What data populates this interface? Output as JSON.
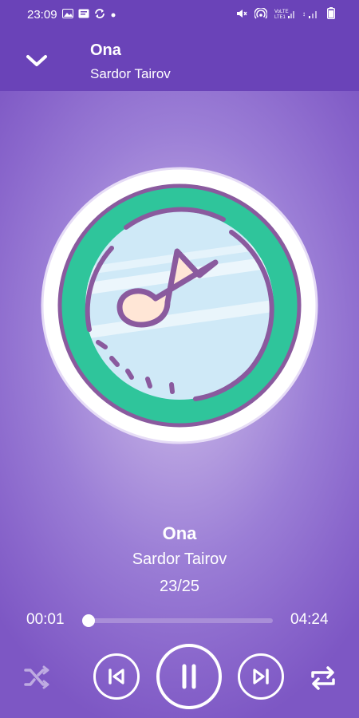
{
  "status_bar": {
    "time": "23:09",
    "left_icons": [
      "gallery-icon",
      "message-icon",
      "sync-icon",
      "dot-icon"
    ],
    "right_icons": [
      "mute-icon",
      "hotspot-icon",
      "signal-volte-lte-icon",
      "signal-icon",
      "battery-icon"
    ]
  },
  "header": {
    "title": "Ona",
    "artist": "Sardor Tairov"
  },
  "now_playing": {
    "title": "Ona",
    "artist": "Sardor Tairov",
    "track_position": "23/25"
  },
  "progress": {
    "current_time": "00:01",
    "total_time": "04:24",
    "fraction": 0.004
  },
  "controls": {
    "shuffle_enabled": false,
    "state": "playing"
  },
  "colors": {
    "accent": "#6a43b8",
    "art_ring": "#2fc59b",
    "art_outline": "#8a5a9e",
    "note_fill": "#ffe6d6"
  }
}
